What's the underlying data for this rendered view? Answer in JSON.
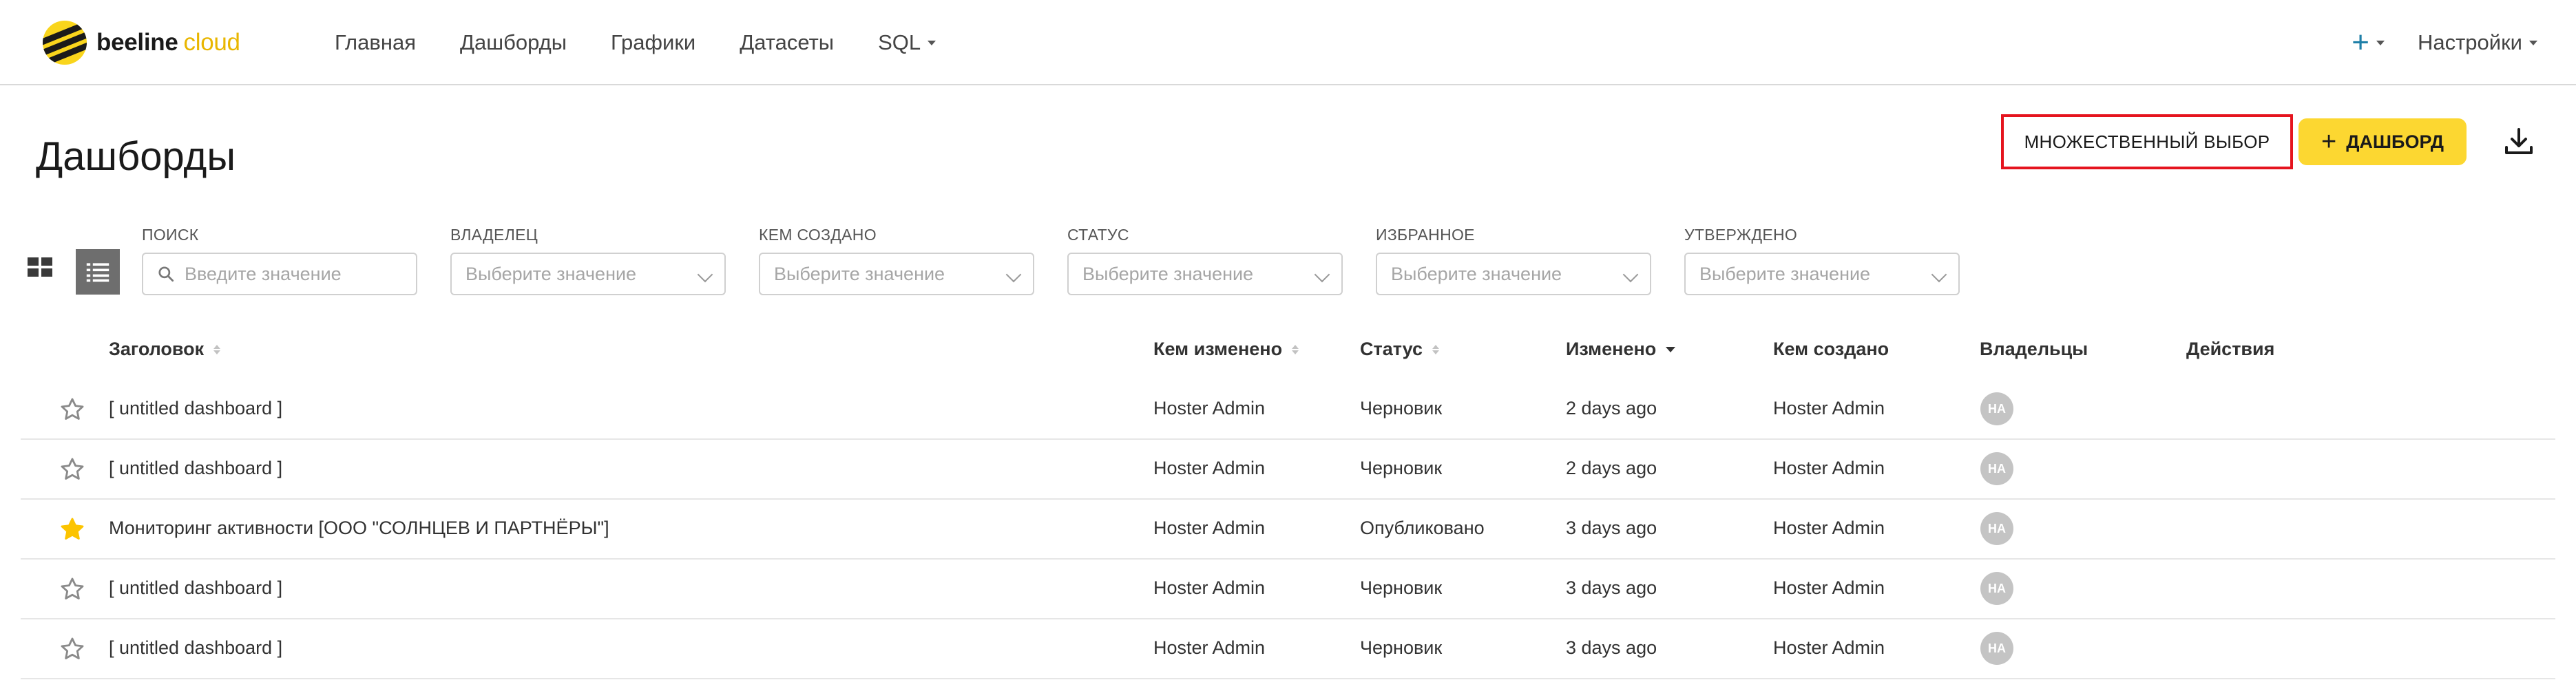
{
  "brand": {
    "name": "beeline",
    "accent": "cloud",
    "color": "#fcd731"
  },
  "nav": {
    "items": [
      {
        "label": "Главная"
      },
      {
        "label": "Дашборды"
      },
      {
        "label": "Графики"
      },
      {
        "label": "Датасеты"
      },
      {
        "label": "SQL"
      }
    ],
    "plus_label": "+",
    "settings_label": "Настройки"
  },
  "page": {
    "title": "Дашборды",
    "multi_select_label": "МНОЖЕСТВЕННЫЙ ВЫБОР",
    "add_dashboard_label": "ДАШБОРД",
    "add_dashboard_plus": "+"
  },
  "filters": {
    "search": {
      "label": "ПОИСК",
      "placeholder": "Введите значение"
    },
    "owner": {
      "label": "ВЛАДЕЛЕЦ",
      "placeholder": "Выберите значение"
    },
    "created_by": {
      "label": "КЕМ СОЗДАНО",
      "placeholder": "Выберите значение"
    },
    "status": {
      "label": "СТАТУС",
      "placeholder": "Выберите значение"
    },
    "favorite": {
      "label": "ИЗБРАННОЕ",
      "placeholder": "Выберите значение"
    },
    "certified": {
      "label": "УТВЕРЖДЕНО",
      "placeholder": "Выберите значение"
    }
  },
  "table": {
    "columns": {
      "title": "Заголовок",
      "modified_by": "Кем изменено",
      "status": "Статус",
      "modified": "Изменено",
      "created_by": "Кем создано",
      "owners": "Владельцы",
      "actions": "Действия"
    },
    "rows": [
      {
        "favorite": false,
        "title": "[ untitled dashboard ]",
        "modified_by": "Hoster Admin",
        "status": "Черновик",
        "modified": "2 days ago",
        "created_by": "Hoster Admin",
        "owner_initials": "HA"
      },
      {
        "favorite": false,
        "title": "[ untitled dashboard ]",
        "modified_by": "Hoster Admin",
        "status": "Черновик",
        "modified": "2 days ago",
        "created_by": "Hoster Admin",
        "owner_initials": "HA"
      },
      {
        "favorite": true,
        "title": "Мониторинг активности [ООО \"СОЛНЦЕВ И ПАРТНЁРЫ\"]",
        "modified_by": "Hoster Admin",
        "status": "Опубликовано",
        "modified": "3 days ago",
        "created_by": "Hoster Admin",
        "owner_initials": "HA"
      },
      {
        "favorite": false,
        "title": "[ untitled dashboard ]",
        "modified_by": "Hoster Admin",
        "status": "Черновик",
        "modified": "3 days ago",
        "created_by": "Hoster Admin",
        "owner_initials": "HA"
      },
      {
        "favorite": false,
        "title": "[ untitled dashboard ]",
        "modified_by": "Hoster Admin",
        "status": "Черновик",
        "modified": "3 days ago",
        "created_by": "Hoster Admin",
        "owner_initials": "HA"
      }
    ]
  },
  "colors": {
    "star_active": "#fcc400",
    "star_inactive": "#8a8a8a",
    "highlight": "#e5141e",
    "accent_blue": "#1e7fa8"
  }
}
